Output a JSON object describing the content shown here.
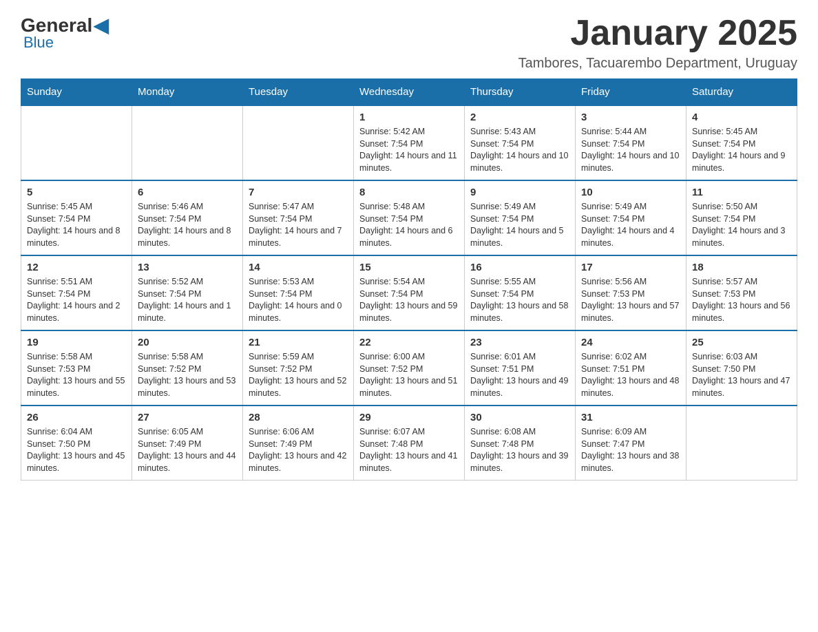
{
  "header": {
    "logo_general": "General",
    "logo_blue": "Blue",
    "month_title": "January 2025",
    "location": "Tambores, Tacuarembo Department, Uruguay"
  },
  "days_of_week": [
    "Sunday",
    "Monday",
    "Tuesday",
    "Wednesday",
    "Thursday",
    "Friday",
    "Saturday"
  ],
  "weeks": [
    [
      {
        "day": "",
        "info": ""
      },
      {
        "day": "",
        "info": ""
      },
      {
        "day": "",
        "info": ""
      },
      {
        "day": "1",
        "info": "Sunrise: 5:42 AM\nSunset: 7:54 PM\nDaylight: 14 hours and 11 minutes."
      },
      {
        "day": "2",
        "info": "Sunrise: 5:43 AM\nSunset: 7:54 PM\nDaylight: 14 hours and 10 minutes."
      },
      {
        "day": "3",
        "info": "Sunrise: 5:44 AM\nSunset: 7:54 PM\nDaylight: 14 hours and 10 minutes."
      },
      {
        "day": "4",
        "info": "Sunrise: 5:45 AM\nSunset: 7:54 PM\nDaylight: 14 hours and 9 minutes."
      }
    ],
    [
      {
        "day": "5",
        "info": "Sunrise: 5:45 AM\nSunset: 7:54 PM\nDaylight: 14 hours and 8 minutes."
      },
      {
        "day": "6",
        "info": "Sunrise: 5:46 AM\nSunset: 7:54 PM\nDaylight: 14 hours and 8 minutes."
      },
      {
        "day": "7",
        "info": "Sunrise: 5:47 AM\nSunset: 7:54 PM\nDaylight: 14 hours and 7 minutes."
      },
      {
        "day": "8",
        "info": "Sunrise: 5:48 AM\nSunset: 7:54 PM\nDaylight: 14 hours and 6 minutes."
      },
      {
        "day": "9",
        "info": "Sunrise: 5:49 AM\nSunset: 7:54 PM\nDaylight: 14 hours and 5 minutes."
      },
      {
        "day": "10",
        "info": "Sunrise: 5:49 AM\nSunset: 7:54 PM\nDaylight: 14 hours and 4 minutes."
      },
      {
        "day": "11",
        "info": "Sunrise: 5:50 AM\nSunset: 7:54 PM\nDaylight: 14 hours and 3 minutes."
      }
    ],
    [
      {
        "day": "12",
        "info": "Sunrise: 5:51 AM\nSunset: 7:54 PM\nDaylight: 14 hours and 2 minutes."
      },
      {
        "day": "13",
        "info": "Sunrise: 5:52 AM\nSunset: 7:54 PM\nDaylight: 14 hours and 1 minute."
      },
      {
        "day": "14",
        "info": "Sunrise: 5:53 AM\nSunset: 7:54 PM\nDaylight: 14 hours and 0 minutes."
      },
      {
        "day": "15",
        "info": "Sunrise: 5:54 AM\nSunset: 7:54 PM\nDaylight: 13 hours and 59 minutes."
      },
      {
        "day": "16",
        "info": "Sunrise: 5:55 AM\nSunset: 7:54 PM\nDaylight: 13 hours and 58 minutes."
      },
      {
        "day": "17",
        "info": "Sunrise: 5:56 AM\nSunset: 7:53 PM\nDaylight: 13 hours and 57 minutes."
      },
      {
        "day": "18",
        "info": "Sunrise: 5:57 AM\nSunset: 7:53 PM\nDaylight: 13 hours and 56 minutes."
      }
    ],
    [
      {
        "day": "19",
        "info": "Sunrise: 5:58 AM\nSunset: 7:53 PM\nDaylight: 13 hours and 55 minutes."
      },
      {
        "day": "20",
        "info": "Sunrise: 5:58 AM\nSunset: 7:52 PM\nDaylight: 13 hours and 53 minutes."
      },
      {
        "day": "21",
        "info": "Sunrise: 5:59 AM\nSunset: 7:52 PM\nDaylight: 13 hours and 52 minutes."
      },
      {
        "day": "22",
        "info": "Sunrise: 6:00 AM\nSunset: 7:52 PM\nDaylight: 13 hours and 51 minutes."
      },
      {
        "day": "23",
        "info": "Sunrise: 6:01 AM\nSunset: 7:51 PM\nDaylight: 13 hours and 49 minutes."
      },
      {
        "day": "24",
        "info": "Sunrise: 6:02 AM\nSunset: 7:51 PM\nDaylight: 13 hours and 48 minutes."
      },
      {
        "day": "25",
        "info": "Sunrise: 6:03 AM\nSunset: 7:50 PM\nDaylight: 13 hours and 47 minutes."
      }
    ],
    [
      {
        "day": "26",
        "info": "Sunrise: 6:04 AM\nSunset: 7:50 PM\nDaylight: 13 hours and 45 minutes."
      },
      {
        "day": "27",
        "info": "Sunrise: 6:05 AM\nSunset: 7:49 PM\nDaylight: 13 hours and 44 minutes."
      },
      {
        "day": "28",
        "info": "Sunrise: 6:06 AM\nSunset: 7:49 PM\nDaylight: 13 hours and 42 minutes."
      },
      {
        "day": "29",
        "info": "Sunrise: 6:07 AM\nSunset: 7:48 PM\nDaylight: 13 hours and 41 minutes."
      },
      {
        "day": "30",
        "info": "Sunrise: 6:08 AM\nSunset: 7:48 PM\nDaylight: 13 hours and 39 minutes."
      },
      {
        "day": "31",
        "info": "Sunrise: 6:09 AM\nSunset: 7:47 PM\nDaylight: 13 hours and 38 minutes."
      },
      {
        "day": "",
        "info": ""
      }
    ]
  ]
}
